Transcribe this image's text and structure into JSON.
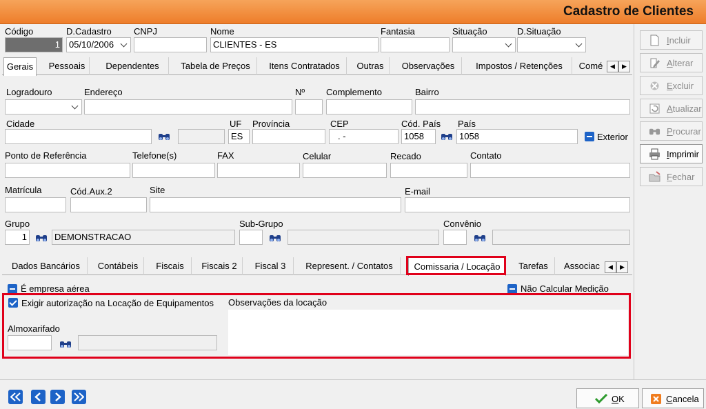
{
  "window": {
    "title": "Cadastro de Clientes"
  },
  "top": {
    "codigo": {
      "label": "Código",
      "value": "1"
    },
    "dcadastro": {
      "label": "D.Cadastro",
      "value": "05/10/2006"
    },
    "cnpj": {
      "label": "CNPJ",
      "value": ""
    },
    "nome": {
      "label": "Nome",
      "value": "CLIENTES - ES"
    },
    "fantasia": {
      "label": "Fantasia",
      "value": ""
    },
    "situacao": {
      "label": "Situação",
      "value": ""
    },
    "dsituacao": {
      "label": "D.Situação",
      "value": ""
    }
  },
  "tabs1": [
    "Gerais",
    "Pessoais",
    "Dependentes",
    "Tabela de Preços",
    "Itens Contratados",
    "Outras",
    "Observações",
    "Impostos / Retenções",
    "Comé"
  ],
  "address": {
    "logradouro": "Logradouro",
    "endereco": "Endereço",
    "numero": "Nº",
    "complemento": "Complemento",
    "bairro": "Bairro",
    "cidade": "Cidade",
    "uf": "UF",
    "uf_value": "ES",
    "provincia": "Província",
    "cep": "CEP",
    "cep_value": ".   -",
    "cod_pais": "Cód. País",
    "cod_pais_value": "1058",
    "pais": "País",
    "pais_value": "1058",
    "exterior": "Exterior"
  },
  "contact": {
    "ponto": "Ponto de Referência",
    "telefone": "Telefone(s)",
    "fax": "FAX",
    "celular": "Celular",
    "recado": "Recado",
    "contato": "Contato"
  },
  "misc": {
    "matricula": "Matrícula",
    "codaux2": "Cód.Aux.2",
    "site": "Site",
    "email": "E-mail"
  },
  "grupo": {
    "label": "Grupo",
    "value": "1",
    "desc": "DEMONSTRACAO",
    "subgrupo": "Sub-Grupo",
    "convenio": "Convênio"
  },
  "tabs2": [
    "Dados Bancários",
    "Contábeis",
    "Fiscais",
    "Fiscais 2",
    "Fiscal 3",
    "Represent. / Contatos",
    "Comissaria / Locação",
    "Tarefas",
    "Associac"
  ],
  "comissaria": {
    "empresa_aerea": "É empresa aérea",
    "nao_calcular": "Não Calcular Medição",
    "exigir": "Exigir autorização na Locação de Equipamentos",
    "obs_label": "Observações da locação",
    "almoxarifado": "Almoxarifado"
  },
  "side": [
    {
      "label": "Incluir",
      "u": "I",
      "rest": "ncluir",
      "icon": "new-doc-icon",
      "enabled": false
    },
    {
      "label": "Alterar",
      "u": "A",
      "rest": "lterar",
      "icon": "edit-icon",
      "enabled": false
    },
    {
      "label": "Excluir",
      "u": "E",
      "rest": "xcluir",
      "icon": "delete-icon",
      "enabled": false
    },
    {
      "label": "Atualizar",
      "u": "A",
      "rest": "tualizar",
      "icon": "refresh-icon",
      "enabled": false
    },
    {
      "label": "Procurar",
      "u": "P",
      "rest": "rocurar",
      "icon": "binoculars-icon",
      "enabled": false
    },
    {
      "label": "Imprimir",
      "u": "I",
      "rest": "mprimir",
      "icon": "printer-icon",
      "enabled": true
    },
    {
      "label": "Fechar",
      "u": "F",
      "rest": "echar",
      "icon": "close-folder-icon",
      "enabled": false
    }
  ],
  "bottom": {
    "ok_u": "O",
    "ok_rest": "K",
    "cancel_u": "C",
    "cancel_rest": "ancela"
  },
  "colors": {
    "accent": "#ee7d2a",
    "blue": "#1d63c7",
    "highlight": "#e0001a"
  }
}
